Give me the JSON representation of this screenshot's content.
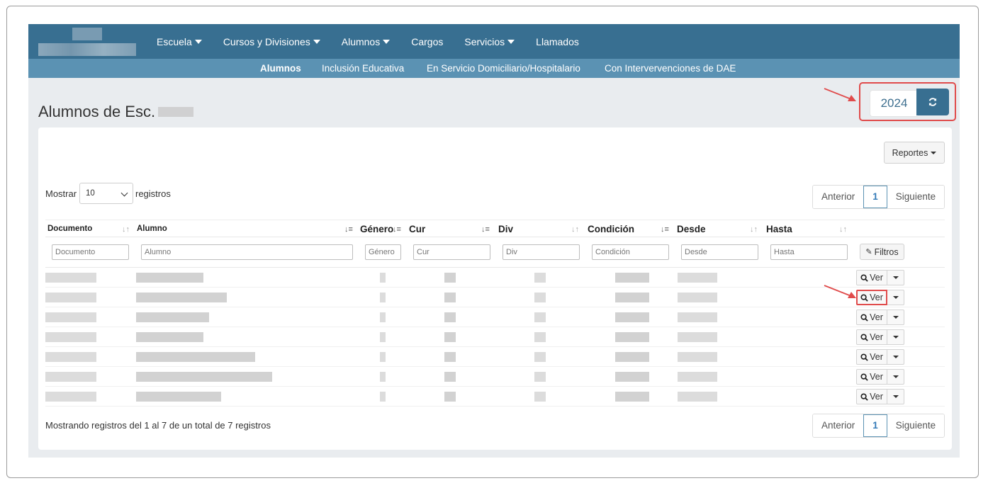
{
  "topnav": {
    "menu": [
      {
        "label": "Escuela",
        "dropdown": true
      },
      {
        "label": "Cursos y Divisiones",
        "dropdown": true
      },
      {
        "label": "Alumnos",
        "dropdown": true
      },
      {
        "label": "Cargos",
        "dropdown": false
      },
      {
        "label": "Servicios",
        "dropdown": true
      },
      {
        "label": "Llamados",
        "dropdown": false
      }
    ]
  },
  "subnav": {
    "items": [
      {
        "label": "Alumnos",
        "active": true
      },
      {
        "label": "Inclusión Educativa",
        "active": false
      },
      {
        "label": "En Servicio Domiciliario/Hospitalario",
        "active": false
      },
      {
        "label": "Con Intervervenciones de DAE",
        "active": false
      }
    ]
  },
  "page": {
    "title": "Alumnos de Esc.",
    "year": "2024",
    "refresh_icon": "refresh-icon"
  },
  "toolbar": {
    "reportes_label": "Reportes",
    "mostrar_label": "Mostrar",
    "registros_label": "registros",
    "page_size": "10",
    "filtros_label": "Filtros"
  },
  "pager": {
    "prev": "Anterior",
    "current": "1",
    "next": "Siguiente"
  },
  "table": {
    "columns": [
      "Documento",
      "Alumno",
      "Género",
      "Cur",
      "Div",
      "Condición",
      "Desde",
      "Hasta"
    ],
    "filters": [
      "Documento",
      "Alumno",
      "Género",
      "Cur",
      "Div",
      "Condición",
      "Desde",
      "Hasta"
    ],
    "row_action": "Ver",
    "row_count": 7
  },
  "footer": {
    "summary": "Mostrando registros del 1 al 7 de un total de 7 registros"
  },
  "colors": {
    "nav": "#386f91",
    "subnav": "#5b92b3",
    "highlight": "#e04b4b"
  }
}
